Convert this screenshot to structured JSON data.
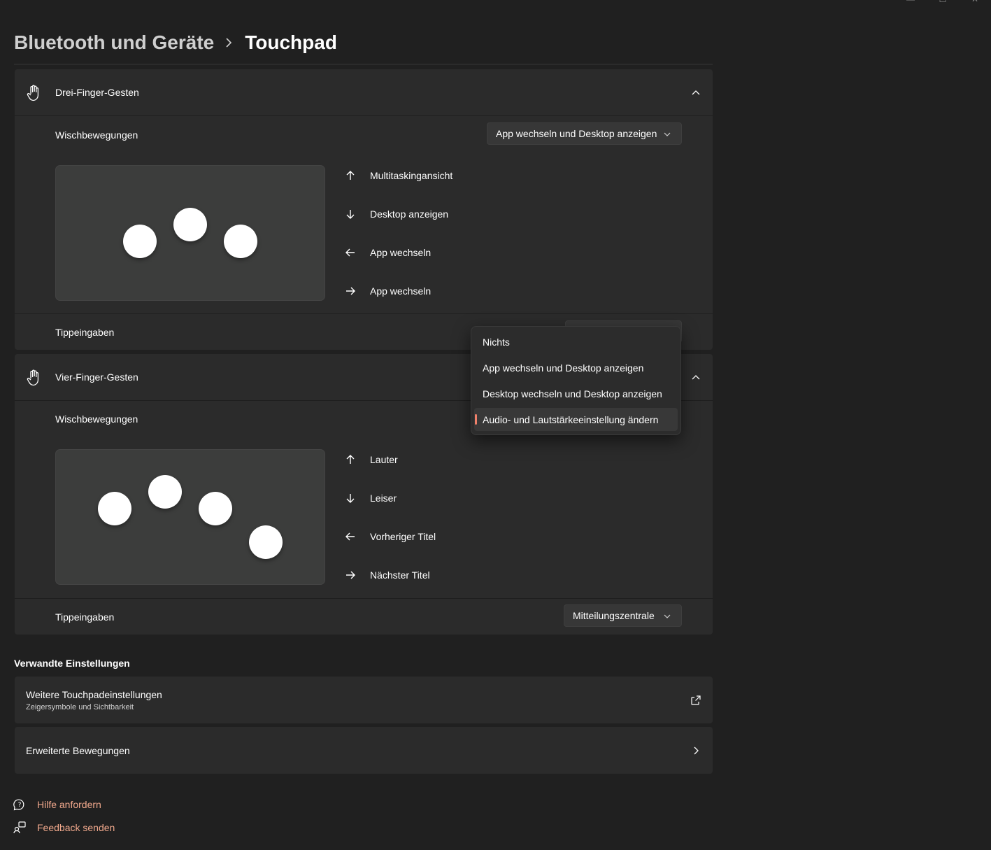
{
  "window": {
    "minimize": "—",
    "maximize": "☐",
    "close": "✕"
  },
  "breadcrumb": {
    "parent": "Bluetooth und Geräte",
    "current": "Touchpad"
  },
  "three_finger": {
    "title": "Drei-Finger-Gesten",
    "swipe_label": "Wischbewegungen",
    "swipe_value": "App wechseln und Desktop anzeigen",
    "directions": [
      {
        "icon": "arrow-up-icon",
        "label": "Multitaskingansicht"
      },
      {
        "icon": "arrow-down-icon",
        "label": "Desktop anzeigen"
      },
      {
        "icon": "arrow-left-icon",
        "label": "App wechseln"
      },
      {
        "icon": "arrow-right-icon",
        "label": "App wechseln"
      }
    ],
    "tap_label": "Tippeingaben"
  },
  "four_finger": {
    "title": "Vier-Finger-Gesten",
    "swipe_label": "Wischbewegungen",
    "directions": [
      {
        "icon": "arrow-up-icon",
        "label": "Lauter"
      },
      {
        "icon": "arrow-down-icon",
        "label": "Leiser"
      },
      {
        "icon": "arrow-left-icon",
        "label": "Vorheriger Titel"
      },
      {
        "icon": "arrow-right-icon",
        "label": "Nächster Titel"
      }
    ],
    "tap_label": "Tippeingaben",
    "tap_value": "Mitteilungszentrale"
  },
  "flyout": {
    "options": [
      "Nichts",
      "App wechseln und Desktop anzeigen",
      "Desktop wechseln und Desktop anzeigen",
      "Audio- und Lautstärkeeinstellung ändern"
    ],
    "selected": "Audio- und Lautstärkeeinstellung ändern"
  },
  "related": {
    "title": "Verwandte Einstellungen",
    "more_touchpad": {
      "title": "Weitere Touchpadeinstellungen",
      "subtitle": "Zeigersymbole und Sichtbarkeit"
    },
    "advanced": {
      "title": "Erweiterte Bewegungen"
    }
  },
  "help": {
    "get_help": "Hilfe anfordern",
    "feedback": "Feedback senden"
  },
  "colors": {
    "background": "#202020",
    "card": "#2b2b2b",
    "accent": "#f0806a",
    "link": "#f0a88c"
  }
}
